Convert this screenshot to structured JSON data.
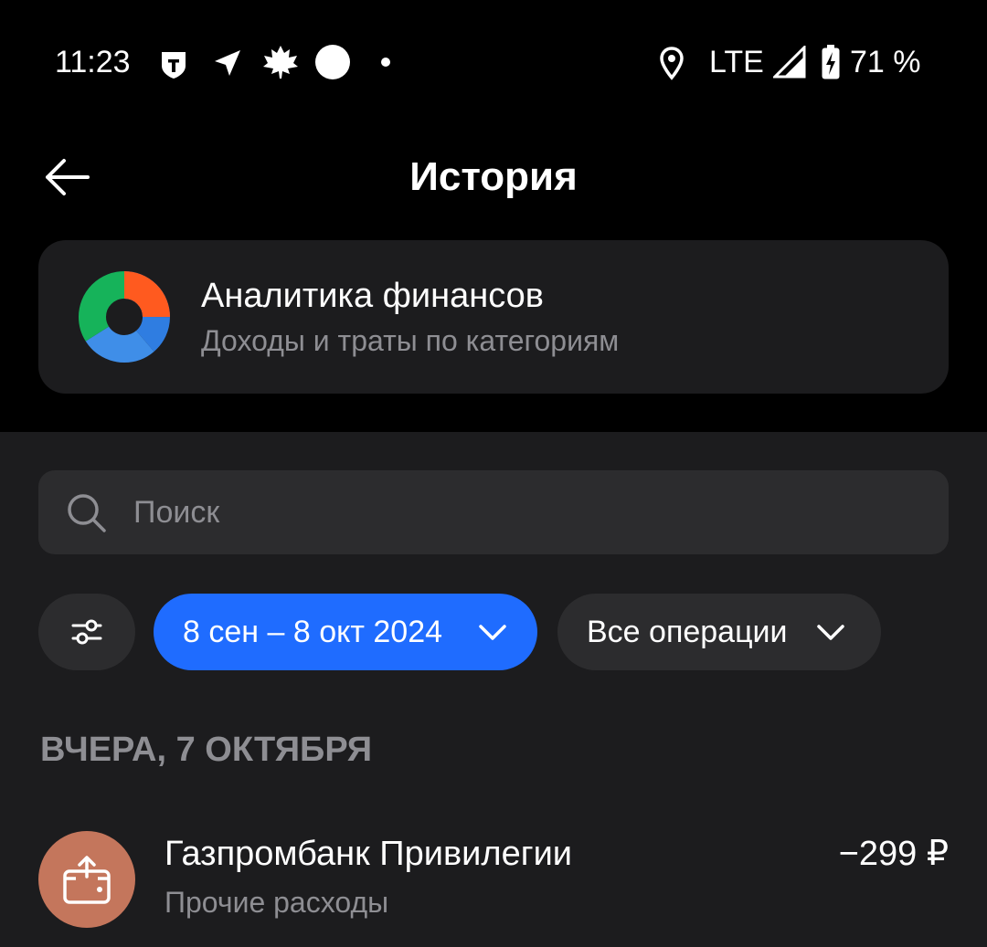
{
  "status_bar": {
    "time": "11:23",
    "network": "LTE",
    "battery": "71 %",
    "icons": [
      "shield-t-icon",
      "navigation-arrow-icon",
      "maple-leaf-icon",
      "white-circle-icon",
      "dot-icon",
      "location-pin-icon",
      "signal-icon",
      "battery-charging-icon"
    ]
  },
  "header": {
    "title": "История",
    "back_icon": "arrow-left-icon"
  },
  "analytics": {
    "title": "Аналитика финансов",
    "subtitle": "Доходы и траты по категориям",
    "colors": [
      "#ff5a1f",
      "#2f7de1",
      "#3f8ee8",
      "#16b35a"
    ]
  },
  "search": {
    "placeholder": "Поиск",
    "value": ""
  },
  "filters": {
    "settings_icon": "sliders-icon",
    "date_range": "8 сен – 8 окт 2024",
    "operations": "Все операции",
    "accent": "#1f6cff"
  },
  "sections": [
    {
      "header": "ВЧЕРА, 7 ОКТЯБРЯ",
      "transactions": [
        {
          "title": "Газпромбанк Привилегии",
          "subtitle": "Прочие расходы",
          "amount": "−299 ₽",
          "icon": "wallet-out-icon",
          "icon_color": "#c4765c"
        }
      ]
    }
  ]
}
